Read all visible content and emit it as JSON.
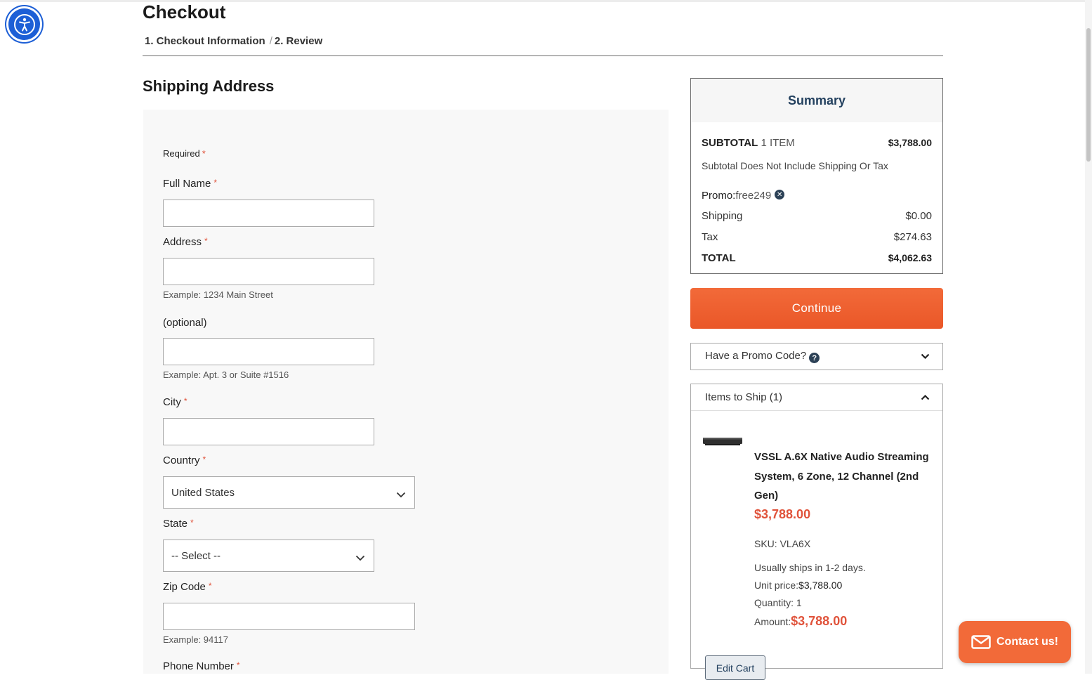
{
  "page": {
    "title": "Checkout",
    "steps": [
      "1. Checkout Information",
      "2. Review"
    ],
    "step_separator": "/"
  },
  "shipping": {
    "section_title": "Shipping Address",
    "required_note": "Required",
    "required_mark": "*",
    "fields": {
      "full_name": {
        "label": "Full Name",
        "value": ""
      },
      "address": {
        "label": "Address",
        "value": "",
        "hint": "Example: 1234 Main Street"
      },
      "address2": {
        "label": "(optional)",
        "value": "",
        "hint": "Example: Apt. 3 or Suite #1516"
      },
      "city": {
        "label": "City",
        "value": ""
      },
      "country": {
        "label": "Country",
        "value": "United States"
      },
      "state": {
        "label": "State",
        "value": "-- Select --"
      },
      "zip": {
        "label": "Zip Code",
        "value": "",
        "hint": "Example: 94117"
      },
      "phone": {
        "label": "Phone Number"
      }
    }
  },
  "summary": {
    "title": "Summary",
    "subtotal_label": "SUBTOTAL",
    "subtotal_count": "1 ITEM",
    "subtotal_value": "$3,788.00",
    "subtotal_note": "Subtotal Does Not Include Shipping Or Tax",
    "promo_label": "Promo:",
    "promo_code": "free249",
    "shipping_label": "Shipping",
    "shipping_value": "$0.00",
    "tax_label": "Tax",
    "tax_value": "$274.63",
    "total_label": "TOTAL",
    "total_value": "$4,062.63"
  },
  "continue_label": "Continue",
  "promo_section": {
    "label": "Have a Promo Code?"
  },
  "items_section": {
    "label": "Items to Ship (1)",
    "product": {
      "name": "VSSL A.6X Native Audio Streaming System, 6 Zone, 12 Channel (2nd Gen)",
      "price": "$3,788.00",
      "sku": "SKU:  VLA6X",
      "ships": "Usually ships in 1-2 days.",
      "unit_price_label": "Unit price:",
      "unit_price": "$3,788.00",
      "quantity": "Quantity: 1",
      "amount_label": "Amount:",
      "amount": "$3,788.00"
    },
    "edit_cart_label": "Edit Cart"
  },
  "contact_label": "Contact us!",
  "colors": {
    "accent": "#f26a39",
    "required": "#e0533b",
    "navy": "#24415f",
    "a11y": "#1d5fd6"
  }
}
